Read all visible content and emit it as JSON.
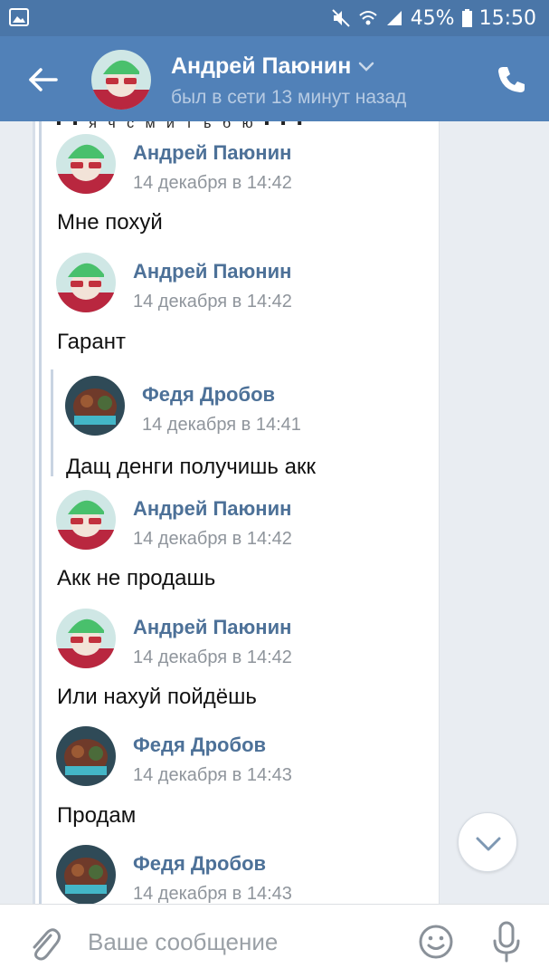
{
  "status_bar": {
    "battery": "45%",
    "time": "15:50"
  },
  "header": {
    "contact_name": "Андрей Паюнин",
    "last_seen": "был в сети 13 минут назад"
  },
  "chat": {
    "cut_off_text": "▪ ▪ я ч с м и т ь б ю ▪ ▪ ▪",
    "messages": [
      {
        "author": "Андрей Паюнин",
        "date": "14 декабря в 14:42",
        "text": "Мне похуй"
      },
      {
        "author": "Андрей Паюнин",
        "date": "14 декабря в 14:42",
        "text": "Гарант"
      },
      {
        "author": "Федя Дробов",
        "date": "14 декабря в 14:41",
        "text": "Дащ денги получишь акк"
      },
      {
        "author": "Андрей Паюнин",
        "date": "14 декабря в 14:42",
        "text": "Акк не продашь"
      },
      {
        "author": "Андрей Паюнин",
        "date": "14 декабря в 14:42",
        "text": "Или нахуй пойдёшь"
      },
      {
        "author": "Федя Дробов",
        "date": "14 декабря в 14:43",
        "text": "Продам"
      },
      {
        "author": "Федя Дробов",
        "date": "14 декабря в 14:43",
        "text": ""
      }
    ]
  },
  "composer": {
    "placeholder": "Ваше сообщение"
  },
  "colors": {
    "header": "#5181b8",
    "status_bar": "#4a76a8",
    "author_name": "#4d7198",
    "chat_background": "#e9edf2"
  },
  "icons": [
    "gallery-icon",
    "mute-icon",
    "wifi-icon",
    "signal-icon",
    "battery-icon",
    "back-arrow-icon",
    "chevron-down-icon",
    "phone-icon",
    "chevron-down-icon",
    "paperclip-icon",
    "emoji-icon",
    "microphone-icon"
  ]
}
